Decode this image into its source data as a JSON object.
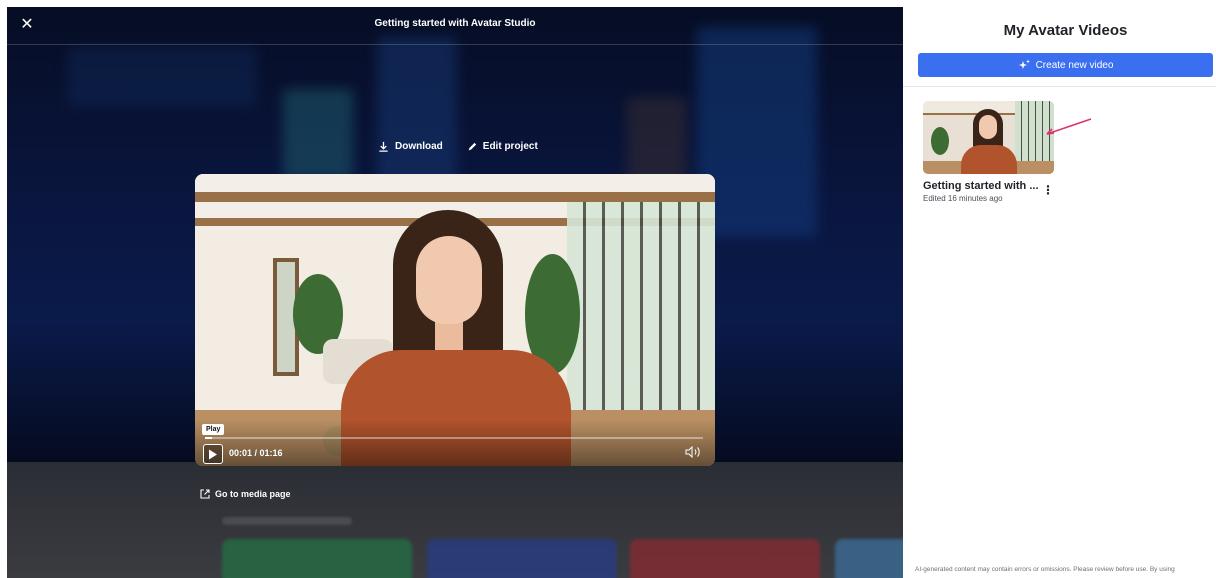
{
  "modal": {
    "title": "Getting started with Avatar Studio",
    "close_label": "✕",
    "actions": {
      "download_label": "Download",
      "edit_label": "Edit project"
    },
    "player": {
      "tooltip": "Play",
      "time": "00:01 / 01:16",
      "progress": 0.0132
    },
    "media_link_label": "Go to media page"
  },
  "panel": {
    "title": "My Avatar Videos",
    "create_button_label": "Create new video",
    "videos": [
      {
        "name": "Getting started with ...",
        "meta": "Edited 16 minutes ago"
      }
    ],
    "disclaimer": "AI-generated content may contain errors or omissions. Please review before use. By using"
  },
  "colors": {
    "accent": "#3a6ff0",
    "annotation_arrow": "#e0336e"
  }
}
